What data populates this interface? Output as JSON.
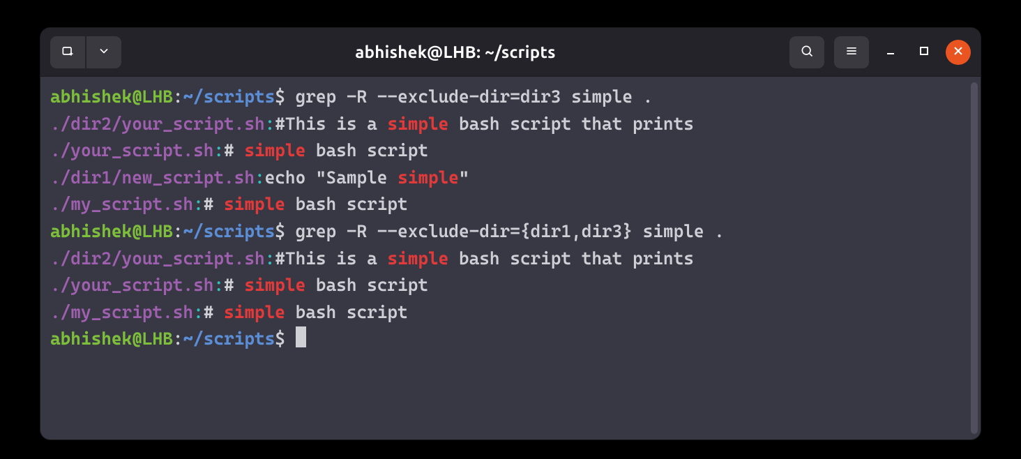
{
  "window": {
    "title": "abhishek@LHB: ~/scripts"
  },
  "colors": {
    "user": "#7dbf3b",
    "path": "#5c8ed6",
    "file": "#a060b0",
    "colon": "#34bfbf",
    "match": "#e13a3a",
    "text": "#cfcfd6",
    "bg_body": "#383744",
    "bg_titlebar": "#242329",
    "close": "#e95420"
  },
  "prompt": {
    "user_host": "abhishek@LHB",
    "sep1": ":",
    "path": "~/scripts",
    "symbol": "$ "
  },
  "lines": [
    {
      "type": "prompt",
      "command": "grep -R --exclude-dir=dir3 simple ."
    },
    {
      "type": "grep",
      "file": "./dir2/your_script.sh",
      "pre": "#This is a ",
      "match": "simple",
      "post": " bash script that prints"
    },
    {
      "type": "grep",
      "file": "./your_script.sh",
      "pre": "# ",
      "match": "simple",
      "post": " bash script"
    },
    {
      "type": "grep",
      "file": "./dir1/new_script.sh",
      "pre": "echo \"Sample ",
      "match": "simple",
      "post": "\""
    },
    {
      "type": "grep",
      "file": "./my_script.sh",
      "pre": "# ",
      "match": "simple",
      "post": " bash script"
    },
    {
      "type": "prompt",
      "command": "grep -R --exclude-dir={dir1,dir3} simple ."
    },
    {
      "type": "grep",
      "file": "./dir2/your_script.sh",
      "pre": "#This is a ",
      "match": "simple",
      "post": " bash script that prints"
    },
    {
      "type": "grep",
      "file": "./your_script.sh",
      "pre": "# ",
      "match": "simple",
      "post": " bash script"
    },
    {
      "type": "grep",
      "file": "./my_script.sh",
      "pre": "# ",
      "match": "simple",
      "post": " bash script"
    },
    {
      "type": "prompt",
      "command": "",
      "cursor": true
    }
  ]
}
